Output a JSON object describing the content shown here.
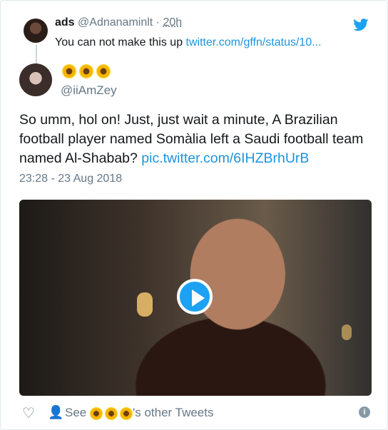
{
  "parent_tweet": {
    "name": "ads",
    "handle": "@Adnanaminlt",
    "separator": "·",
    "time": "20h",
    "text": "You can not make this up",
    "link": "twitter.com/gffn/status/10..."
  },
  "tweet": {
    "author_display": "🌻🌻🌻",
    "author_handle": "@iiAmZey",
    "text": "So umm, hol on! Just, just wait a minute, A Brazilian football player named Somàlia left a Saudi football team named Al-Shabab?",
    "link": "pic.twitter.com/6IHZBrhUrB",
    "timestamp": "23:28 - 23 Aug 2018"
  },
  "footer": {
    "see_label": "See",
    "other_tweets": "'s other Tweets",
    "info": "i"
  },
  "colors": {
    "link": "#1b95e0",
    "twitter_blue": "#1da1f2",
    "secondary": "#657786"
  },
  "icons": [
    "twitter-bird-icon",
    "heart-icon",
    "person-icon",
    "info-icon",
    "play-icon",
    "sunflower-icon"
  ]
}
